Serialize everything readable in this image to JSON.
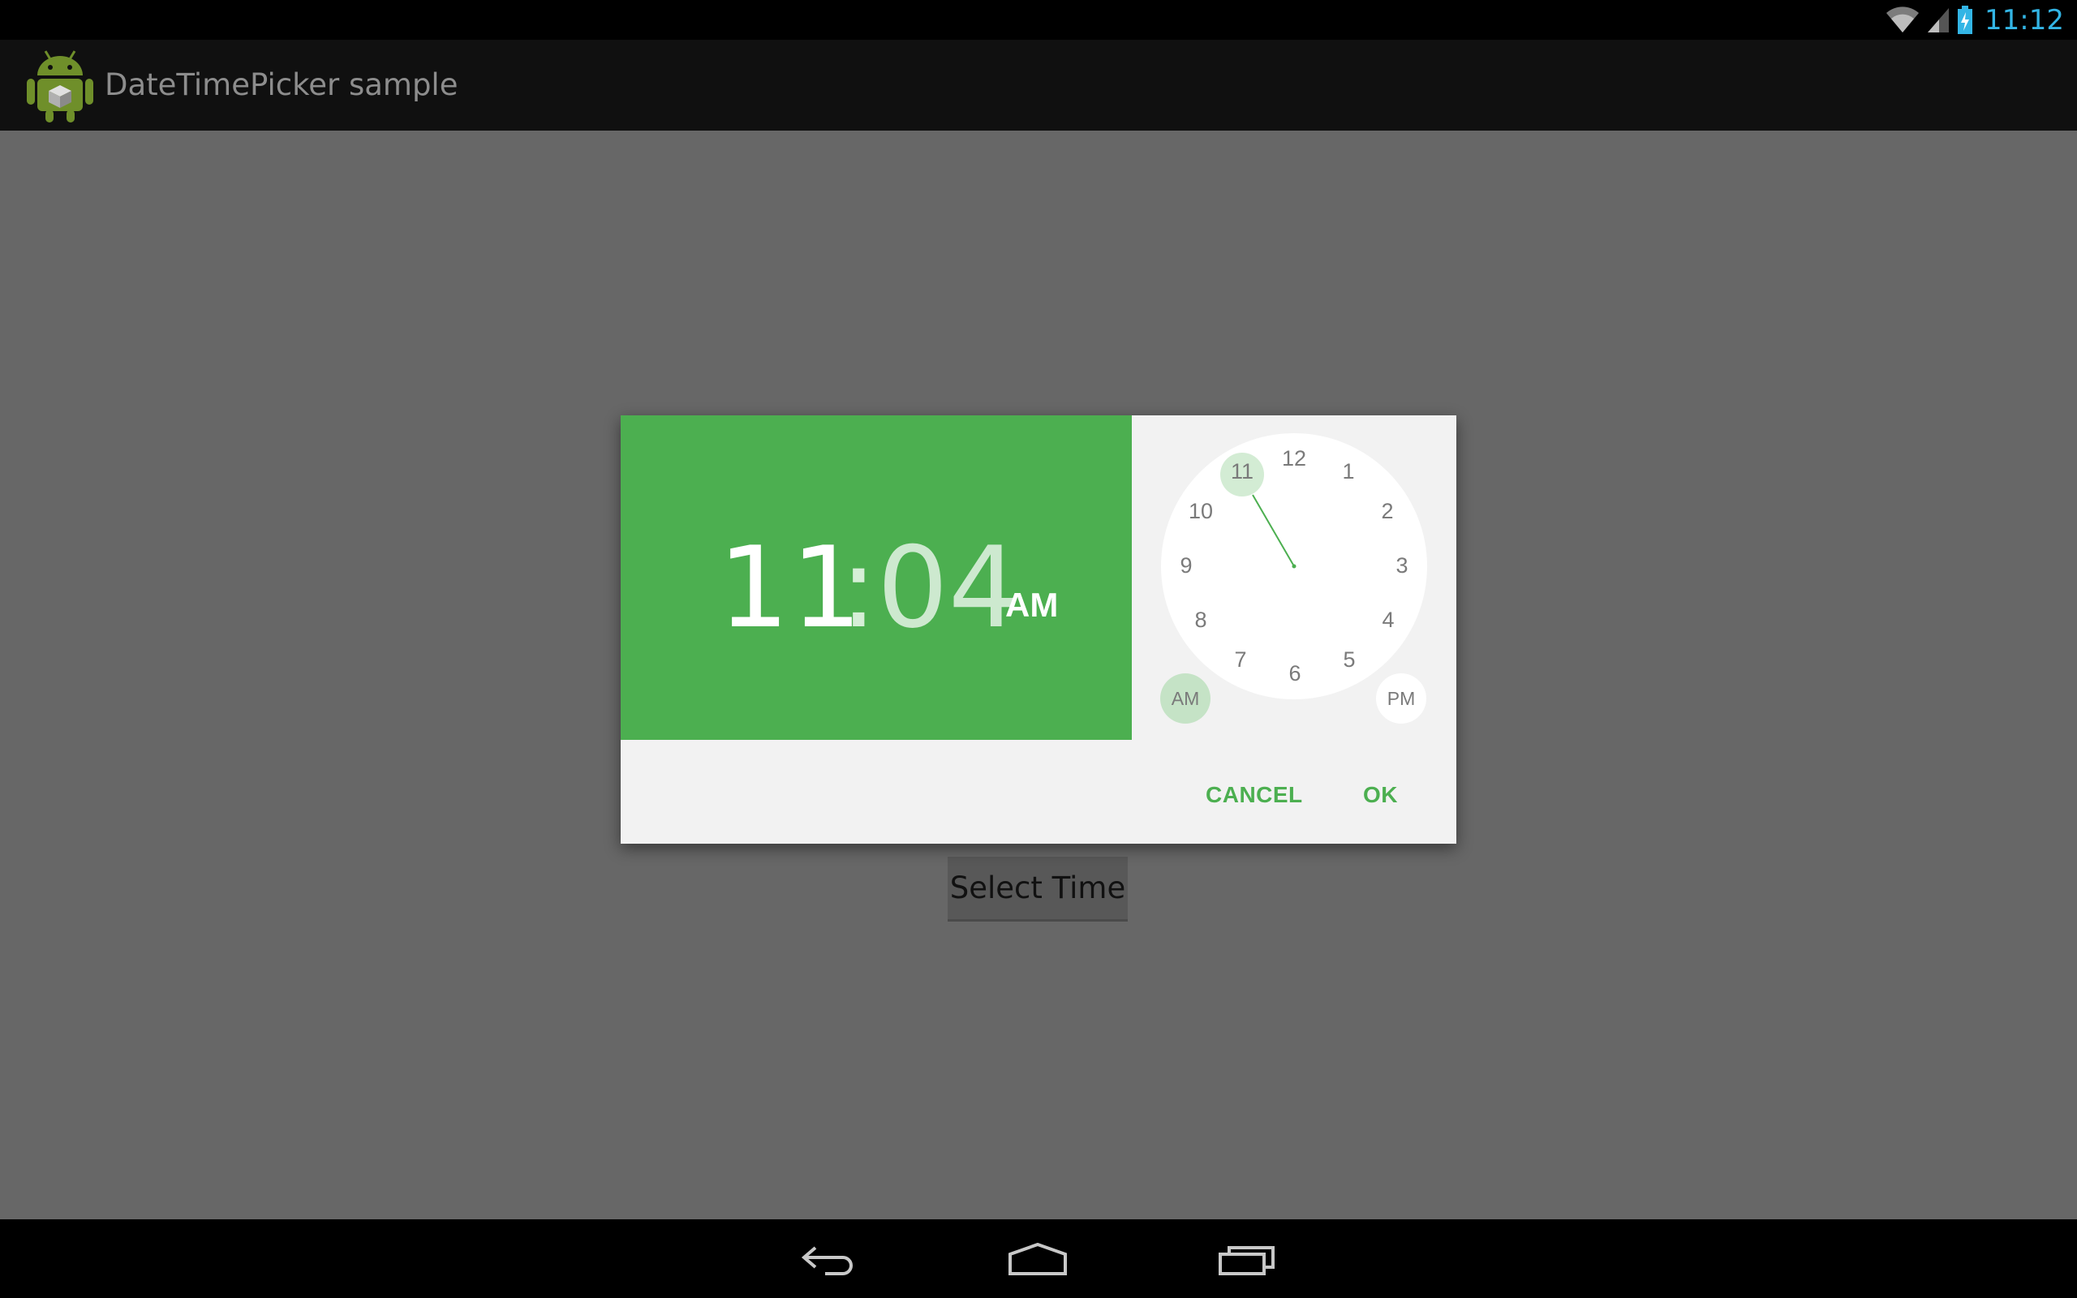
{
  "status_bar": {
    "time": "11:12",
    "icons": [
      "wifi-icon",
      "cell-signal-icon",
      "battery-charging-icon"
    ],
    "accent_color": "#33b5e5"
  },
  "action_bar": {
    "title": "DateTimePicker sample",
    "icon": "android-app-icon"
  },
  "main": {
    "select_time_label": "Select Time"
  },
  "dialog": {
    "header_color": "#4caf50",
    "time": {
      "hour": "11",
      "separator": ":",
      "minute": "04",
      "ampm": "AM"
    },
    "clock": {
      "numbers": [
        "12",
        "1",
        "2",
        "3",
        "4",
        "5",
        "6",
        "7",
        "8",
        "9",
        "10",
        "11"
      ],
      "selected": "11",
      "am_label": "AM",
      "pm_label": "PM",
      "selected_period": "AM"
    },
    "buttons": {
      "cancel": "CANCEL",
      "ok": "OK"
    }
  },
  "nav_bar": {
    "icons": [
      "back-icon",
      "home-icon",
      "recents-icon"
    ]
  }
}
